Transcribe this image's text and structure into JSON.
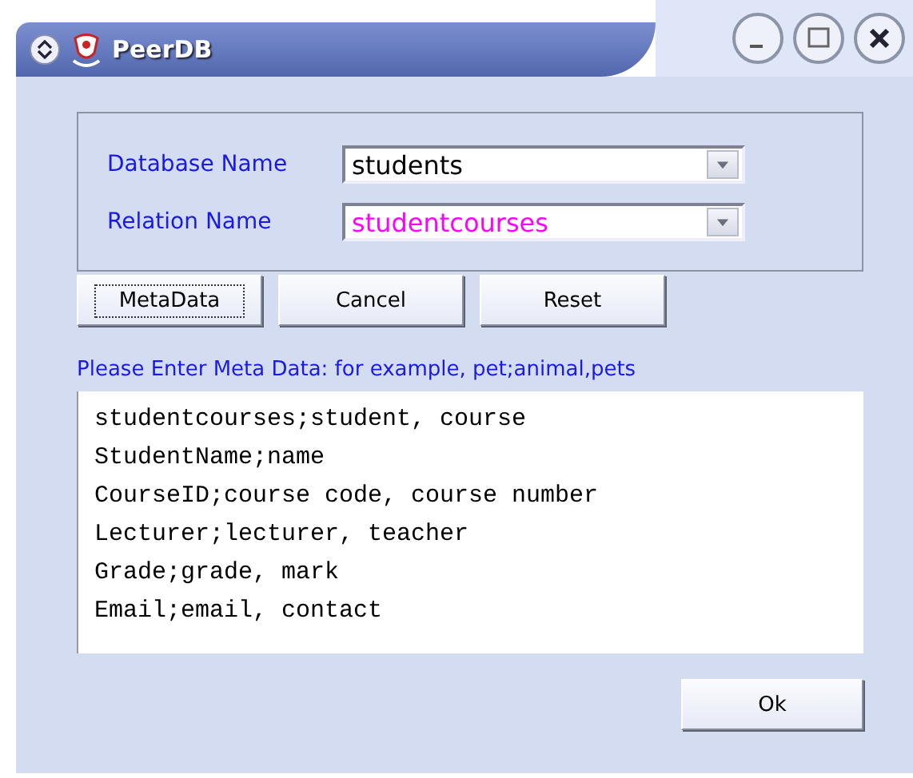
{
  "window": {
    "title": "PeerDB"
  },
  "fields": [
    {
      "label": "Database Name",
      "value": "students",
      "color": "#000000"
    },
    {
      "label": "Relation Name",
      "value": "studentcourses",
      "color": "#ff00ff"
    }
  ],
  "buttons": [
    {
      "label": "MetaData",
      "focused": true
    },
    {
      "label": "Cancel",
      "focused": false
    },
    {
      "label": "Reset",
      "focused": false
    }
  ],
  "hint": "Please Enter Meta Data: for example, pet;animal,pets",
  "metadata_lines": [
    "studentcourses;student, course",
    "StudentName;name",
    "CourseID;course code, course number",
    "Lecturer;lecturer, teacher",
    "Grade;grade, mark",
    "Email;email, contact"
  ],
  "ok_button": {
    "label": "Ok",
    "focused": false
  }
}
